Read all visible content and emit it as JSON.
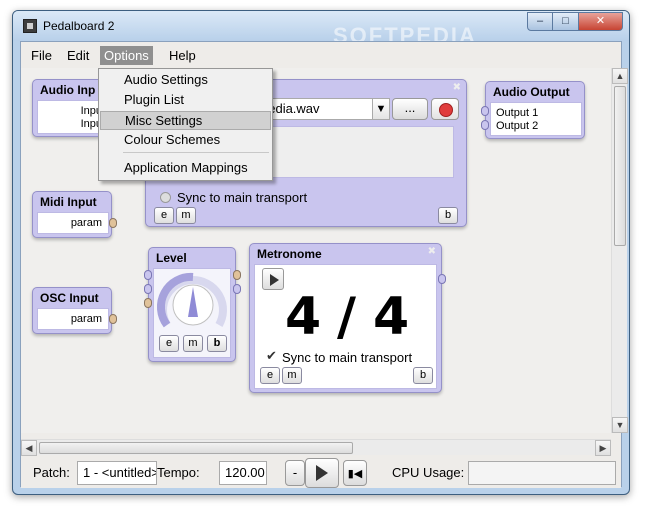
{
  "window": {
    "title": "Pedalboard 2",
    "watermark": "SOFTPEDIA"
  },
  "menubar": {
    "file": "File",
    "edit": "Edit",
    "options": "Options",
    "help": "Help"
  },
  "options_menu": {
    "items": [
      "Audio Settings",
      "Plugin List",
      "Misc Settings",
      "Colour Schemes",
      "Application Mappings"
    ],
    "selected": "Misc Settings"
  },
  "nodes": {
    "audio_input": {
      "title": "Audio Inp",
      "outputs": [
        "Inpu",
        "Inpu"
      ]
    },
    "midi_input": {
      "title": "Midi Input",
      "param": "param"
    },
    "osc_input": {
      "title": "OSC Input",
      "param": "param"
    },
    "file_player": {
      "file": "pedia.wav",
      "browse": "...",
      "sync_label": "Sync to main transport",
      "e": "e",
      "m": "m",
      "b": "b"
    },
    "level": {
      "title": "Level",
      "e": "e",
      "m": "m",
      "b": "b"
    },
    "metronome": {
      "title": "Metronome",
      "numerator": "4",
      "slash": "/",
      "denominator": "4",
      "sync_label": "Sync to main transport",
      "e": "e",
      "m": "m",
      "b": "b"
    },
    "audio_output": {
      "title": "Audio Output",
      "inputs": [
        "Output 1",
        "Output 2"
      ]
    }
  },
  "bottombar": {
    "patch_label": "Patch:",
    "patch_value": "1 - <untitled>",
    "tempo_label": "Tempo:",
    "tempo_value": "120.00",
    "minus": "-",
    "cpu_label": "CPU Usage:"
  },
  "colors": {
    "node_fill": "#c9c5ee",
    "canvas": "#f0efed",
    "record": "#e03c3c"
  }
}
